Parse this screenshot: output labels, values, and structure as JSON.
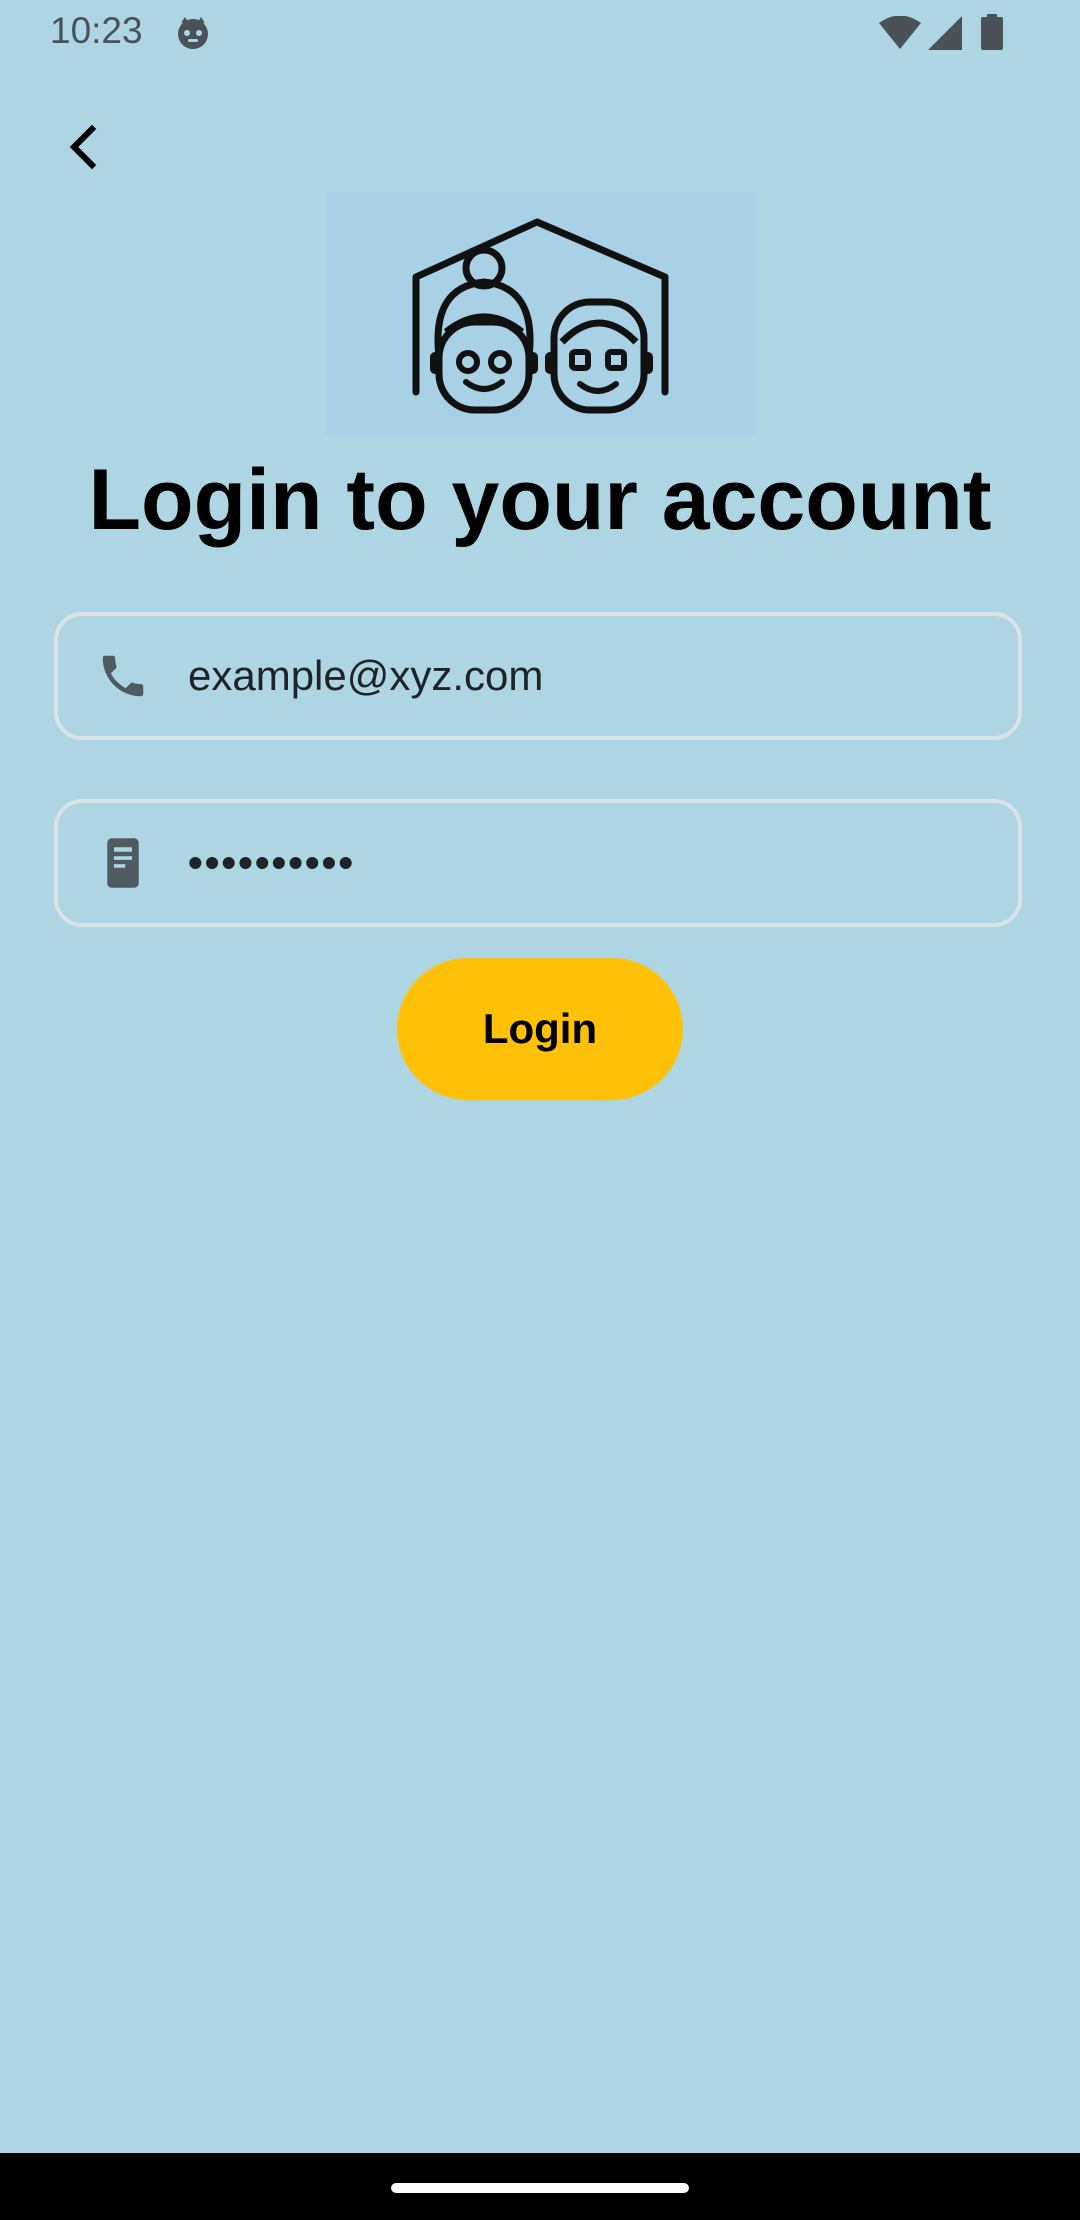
{
  "status_bar": {
    "time": "10:23",
    "app_icon": "android-cat-icon",
    "wifi_icon": "wifi-icon",
    "signal_icon": "cell-signal-icon",
    "battery_icon": "battery-icon"
  },
  "header": {
    "back_icon": "chevron-left-icon"
  },
  "logo": {
    "icon": "elderly-couple-house-icon"
  },
  "title": "Login to your account",
  "form": {
    "email": {
      "icon": "phone-icon",
      "value": "example@xyz.com"
    },
    "password": {
      "icon": "smartphone-icon",
      "value": "••••••••••"
    },
    "login_label": "Login"
  },
  "colors": {
    "background": "#ADD6E2",
    "button": "#FFC107",
    "field_border": "#dce3e6",
    "nav_bar": "#000000"
  }
}
